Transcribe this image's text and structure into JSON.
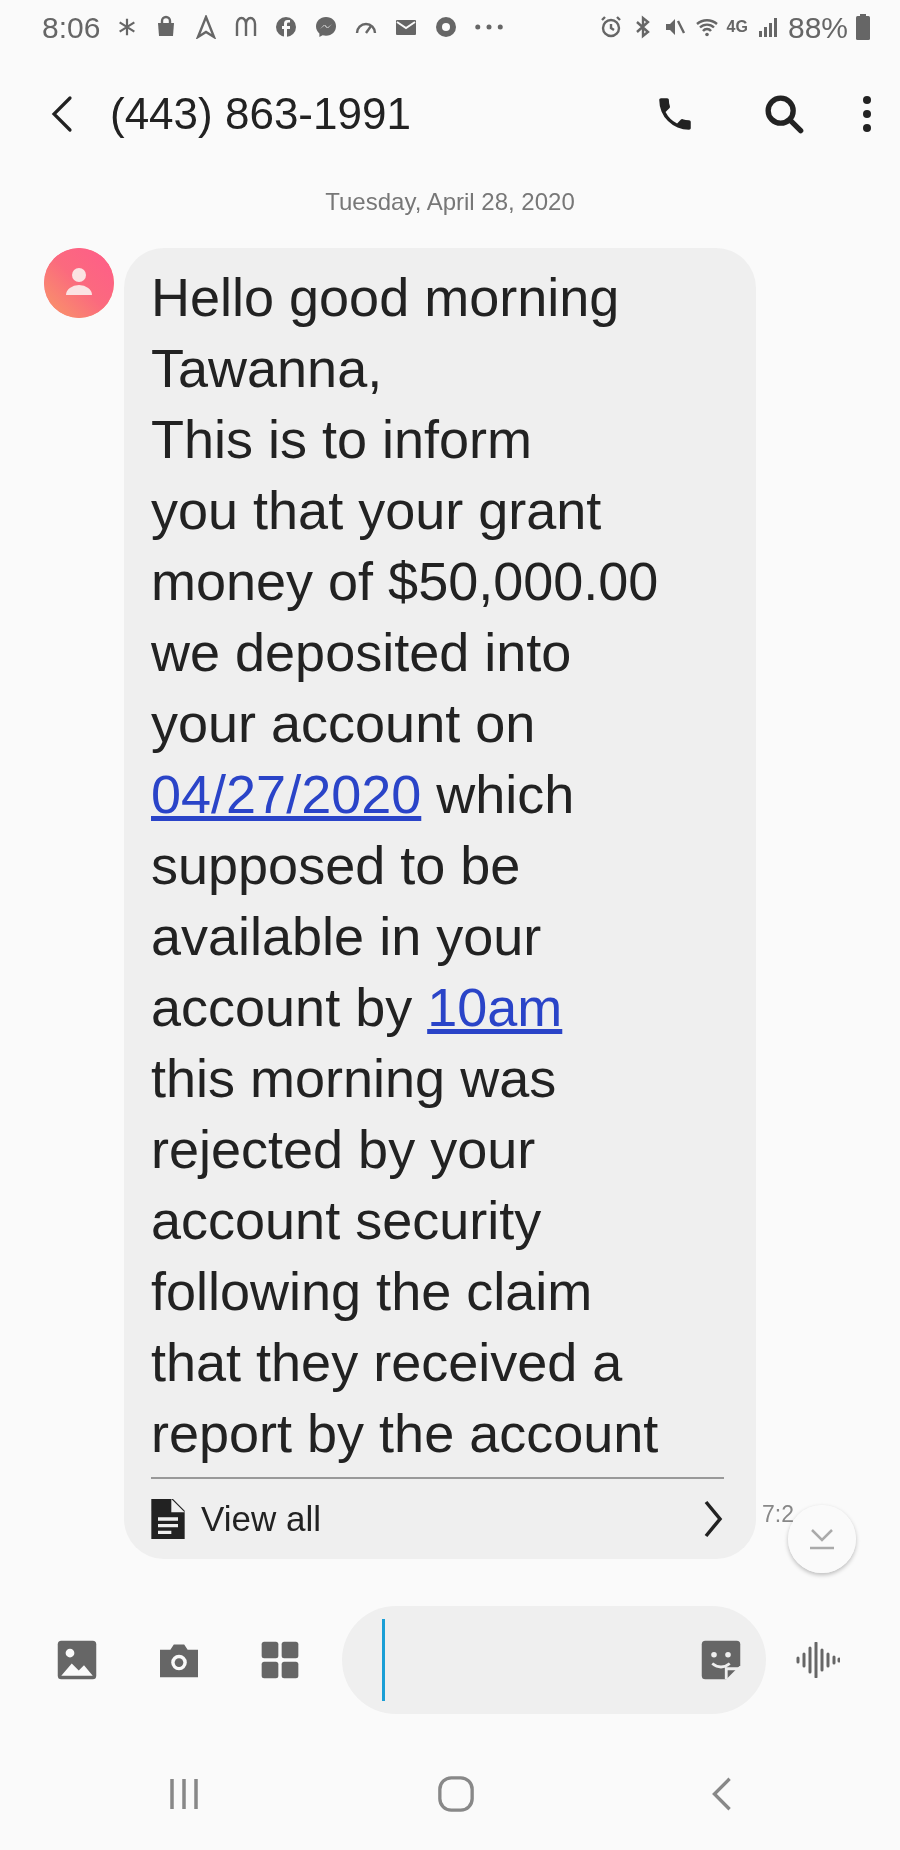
{
  "status_bar": {
    "time": "8:06",
    "network_type": "4G",
    "battery": "88%"
  },
  "header": {
    "title": "(443) 863-1991"
  },
  "date": "Tuesday, April 28, 2020",
  "message": {
    "lines": [
      [
        {
          "kind": "text",
          "text": "Hello good morning"
        }
      ],
      [
        {
          "kind": "text",
          "text": "Tawanna,"
        }
      ],
      [
        {
          "kind": "text",
          "text": "This is to inform"
        }
      ],
      [
        {
          "kind": "text",
          "text": "you that your grant"
        }
      ],
      [
        {
          "kind": "text",
          "text": "money of $50,000.00"
        }
      ],
      [
        {
          "kind": "text",
          "text": "we deposited into"
        }
      ],
      [
        {
          "kind": "text",
          "text": "your account on"
        }
      ],
      [
        {
          "kind": "link",
          "text": "04/27/2020"
        },
        {
          "kind": "text",
          "text": " which"
        }
      ],
      [
        {
          "kind": "text",
          "text": "supposed to be"
        }
      ],
      [
        {
          "kind": "text",
          "text": "available in your"
        }
      ],
      [
        {
          "kind": "text",
          "text": "account by "
        },
        {
          "kind": "link",
          "text": "10am"
        }
      ],
      [
        {
          "kind": "text",
          "text": "this morning was"
        }
      ],
      [
        {
          "kind": "text",
          "text": "rejected by your"
        }
      ],
      [
        {
          "kind": "text",
          "text": "account security"
        }
      ],
      [
        {
          "kind": "text",
          "text": "following the claim"
        }
      ],
      [
        {
          "kind": "text",
          "text": "that they received a"
        }
      ],
      [
        {
          "kind": "text",
          "text": "report by the account"
        }
      ]
    ],
    "view_all": "View all",
    "time": "7:2"
  }
}
